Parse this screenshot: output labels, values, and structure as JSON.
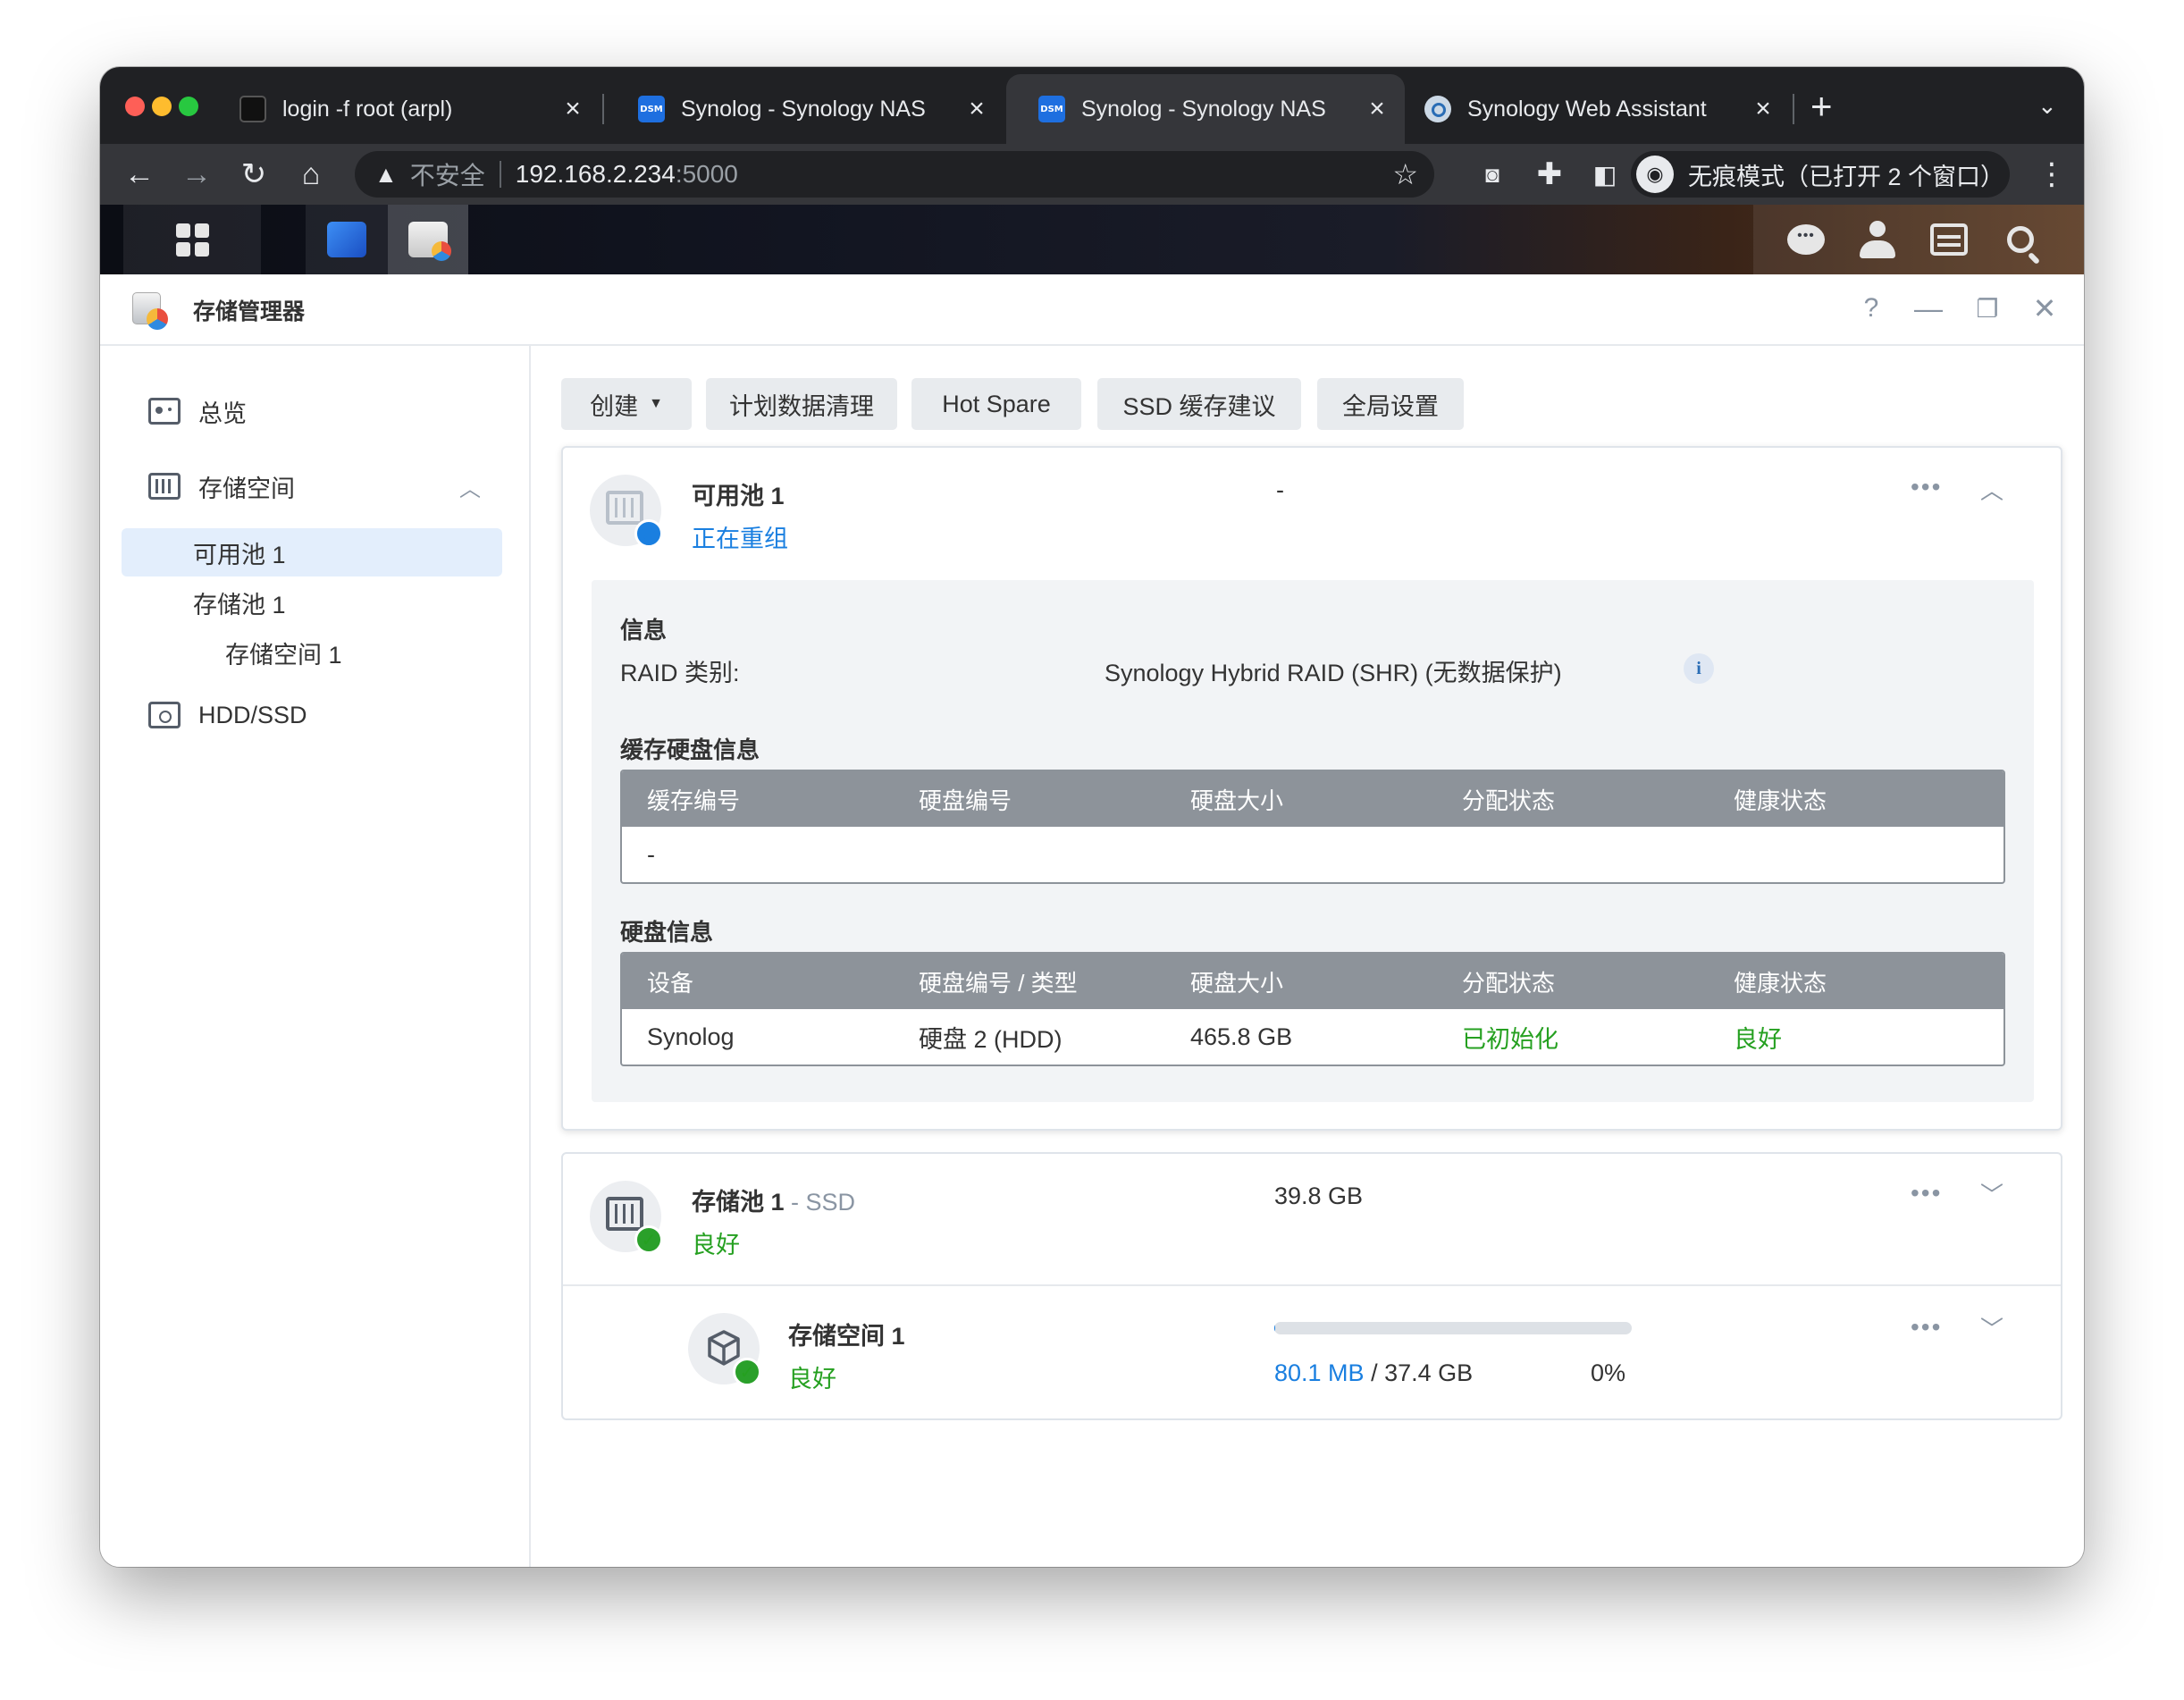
{
  "browser": {
    "tabs": [
      {
        "title": "login -f root (arpl)",
        "favicon": "terminal-icon"
      },
      {
        "title": "Synolog - Synology NAS",
        "favicon": "dsm-icon"
      },
      {
        "title": "Synolog - Synology NAS",
        "favicon": "dsm-icon",
        "active": true
      },
      {
        "title": "Synology Web Assistant",
        "favicon": "web-assistant-icon"
      }
    ],
    "favicon_dsm_text": "DSM",
    "address": {
      "security_label": "不安全",
      "host": "192.168.2.234",
      "port": ":5000"
    },
    "incognito_label": "无痕模式（已打开 2 个窗口）"
  },
  "app": {
    "title": "存储管理器",
    "help": "?",
    "sidebar": {
      "overview": "总览",
      "storage": "存储空间",
      "pool_available": "可用池 1",
      "storage_pool": "存储池 1",
      "volume": "存储空间 1",
      "hdd": "HDD/SSD"
    },
    "toolbar": {
      "create": "创建",
      "scrub": "计划数据清理",
      "hotspare": "Hot Spare",
      "ssd_cache": "SSD 缓存建议",
      "global": "全局设置"
    },
    "pool_card": {
      "title": "可用池 1",
      "status": "正在重组",
      "size": "-",
      "info_heading": "信息",
      "raid_label": "RAID 类别:",
      "raid_value": "Synology Hybrid RAID (SHR) (无数据保护)",
      "cache_heading": "缓存硬盘信息",
      "cache_columns": [
        "缓存编号",
        "硬盘编号",
        "硬盘大小",
        "分配状态",
        "健康状态"
      ],
      "cache_empty": "-",
      "disk_heading": "硬盘信息",
      "disk_columns": [
        "设备",
        "硬盘编号 / 类型",
        "硬盘大小",
        "分配状态",
        "健康状态"
      ],
      "disk_row": {
        "device": "Synolog",
        "disk": "硬盘 2 (HDD)",
        "size": "465.8 GB",
        "alloc": "已初始化",
        "health": "良好"
      }
    },
    "storage_pool_card": {
      "title": "存储池 1",
      "title_suffix": " - SSD",
      "status": "良好",
      "size": "39.8 GB"
    },
    "volume_card": {
      "title": "存储空间 1",
      "status": "良好",
      "used": "80.1 MB",
      "separator": " / ",
      "total": "37.4 GB",
      "percent": "0%",
      "usage_fraction": 0.002
    }
  },
  "colors": {
    "accent_blue": "#1a7fe0",
    "status_green": "#25a020",
    "selected_nav": "#e3eefc"
  }
}
